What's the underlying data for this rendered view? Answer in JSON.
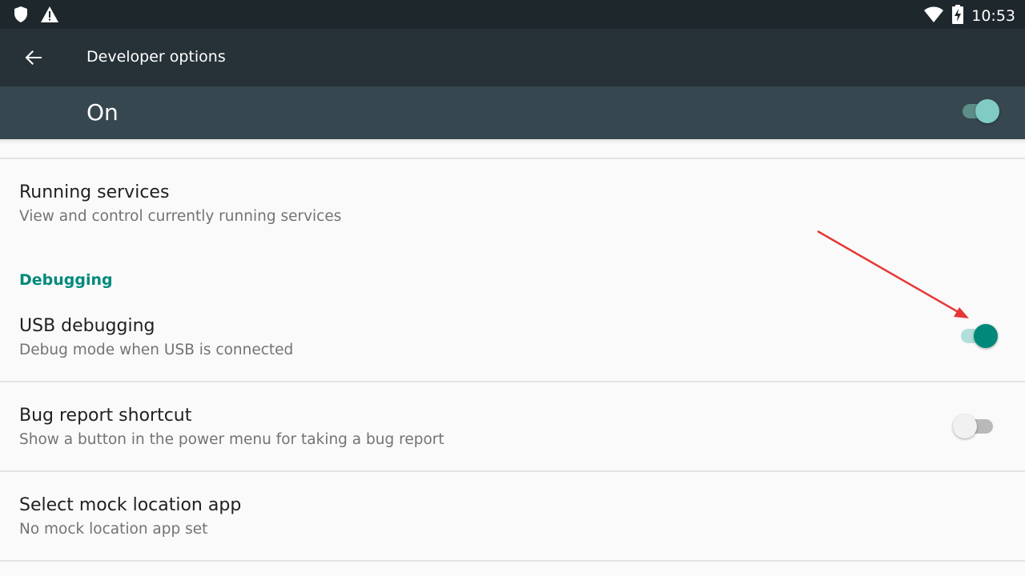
{
  "status_bar": {
    "time": "10:53",
    "left_icons": [
      "shield-icon",
      "alert-icon"
    ],
    "right_icons": [
      "wifi-icon",
      "battery-charging-icon"
    ]
  },
  "app_bar": {
    "back_icon": "arrow-back-icon",
    "title": "Developer options"
  },
  "master_switch": {
    "label": "On",
    "checked": true
  },
  "items": {
    "running_services": {
      "title": "Running services",
      "summary": "View and control currently running services"
    },
    "debugging_category": "Debugging",
    "usb_debugging": {
      "title": "USB debugging",
      "summary": "Debug mode when USB is connected",
      "checked": true
    },
    "bug_report_shortcut": {
      "title": "Bug report shortcut",
      "summary": "Show a button in the power menu for taking a bug report",
      "checked": false
    },
    "mock_location": {
      "title": "Select mock location app",
      "summary": "No mock location app set"
    }
  },
  "colors": {
    "accent": "#00897b",
    "annotation_arrow": "#e53935",
    "app_bar": "#263238",
    "master_bar": "#37474f"
  }
}
